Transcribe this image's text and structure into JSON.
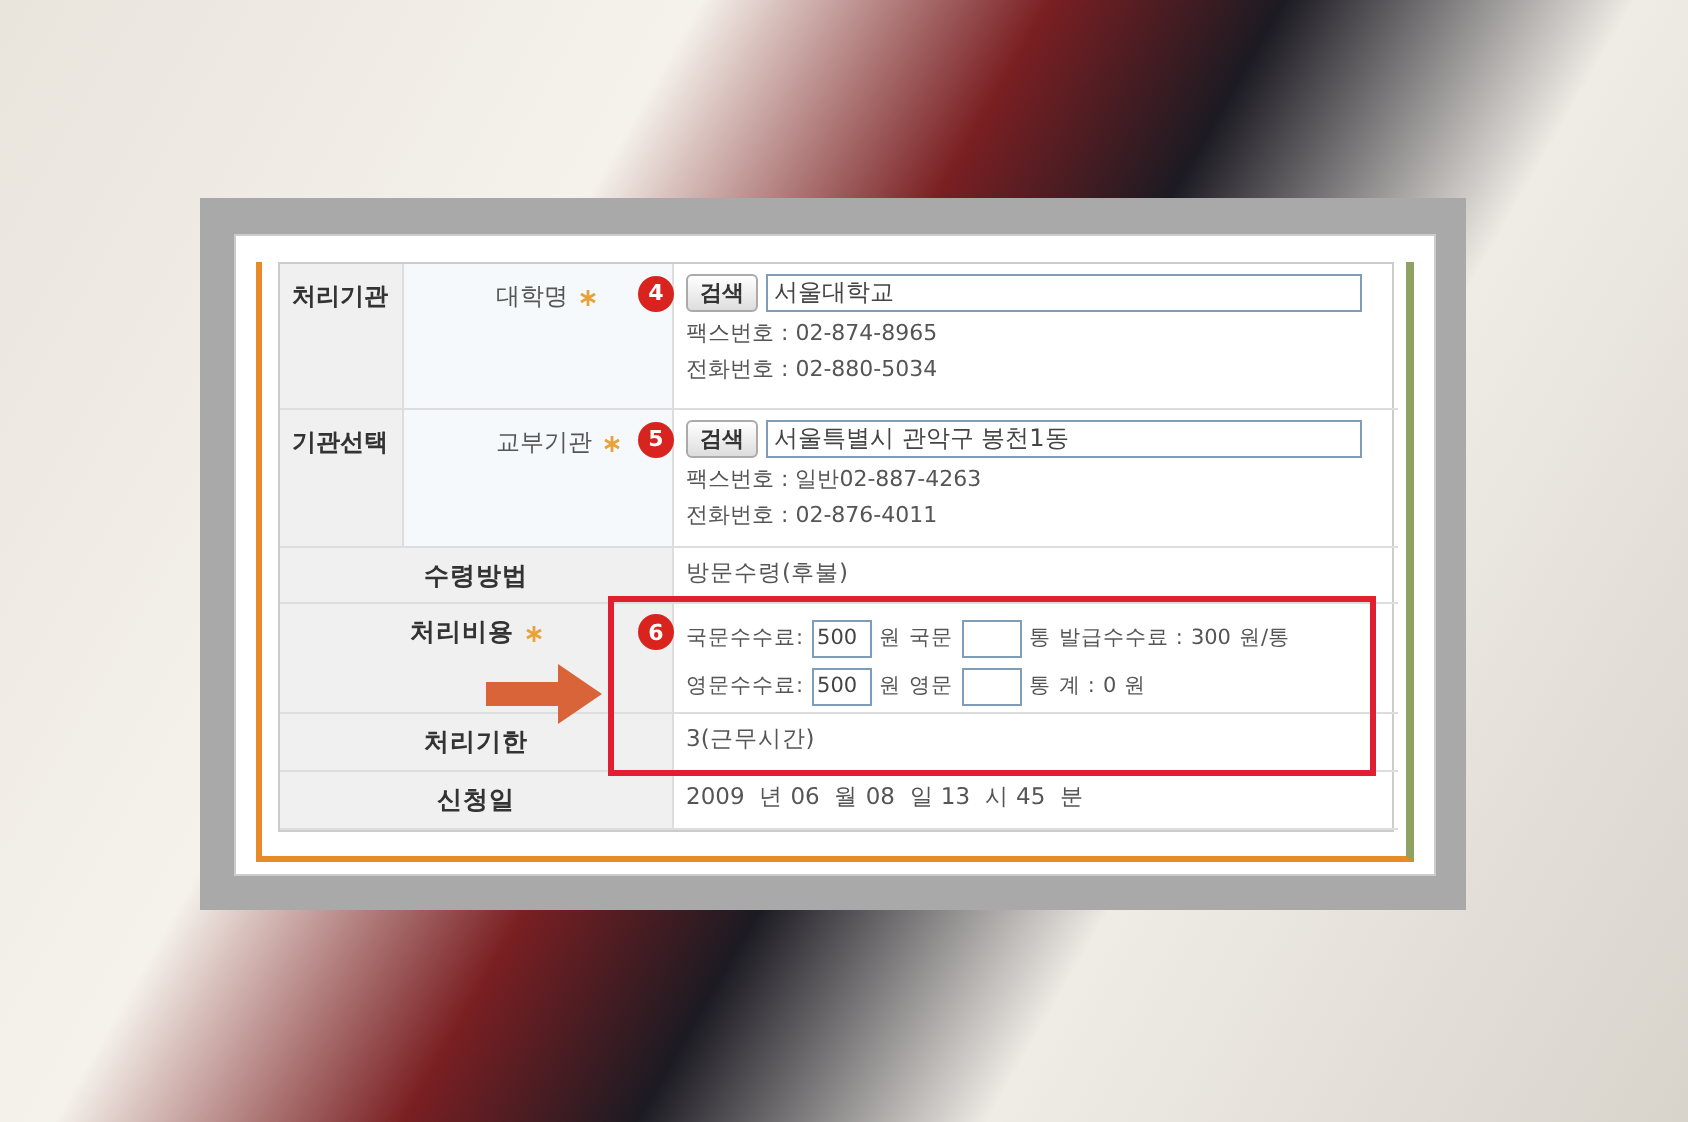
{
  "rows": [
    {
      "kind": "lookup",
      "group": "처리기관",
      "label": "대학명",
      "required": true,
      "badge": "4",
      "button": "검색",
      "value": "서울대학교",
      "details": [
        {
          "label": "팩스번호 :",
          "value": "02-874-8965"
        },
        {
          "label": "전화번호 :",
          "value": "02-880-5034"
        }
      ]
    },
    {
      "kind": "lookup",
      "group": "기관선택",
      "label": "교부기관",
      "required": true,
      "badge": "5",
      "button": "검색",
      "value": "서울특별시 관악구 봉천1동",
      "details": [
        {
          "label": "팩스번호 :",
          "value": "일반02-887-4263"
        },
        {
          "label": "전화번호 :",
          "value": "02-876-4011"
        }
      ]
    },
    {
      "kind": "text",
      "label": "수령방법",
      "required": false,
      "value": "방문수령(후불)"
    },
    {
      "kind": "fees",
      "label": "처리비용",
      "required": true,
      "badge": "6",
      "lines": [
        [
          {
            "kind": "text",
            "text": "국문수수료:"
          },
          {
            "kind": "input",
            "value": "500"
          },
          {
            "kind": "text",
            "text": "원"
          },
          {
            "kind": "text",
            "text": "국문"
          },
          {
            "kind": "input"
          },
          {
            "kind": "text",
            "text": "통"
          },
          {
            "kind": "text",
            "text": "발급수수료 :"
          },
          {
            "kind": "text",
            "text": "300"
          },
          {
            "kind": "text",
            "text": "원/통"
          }
        ],
        [
          {
            "kind": "text",
            "text": "영문수수료:"
          },
          {
            "kind": "input",
            "value": "500"
          },
          {
            "kind": "text",
            "text": "원"
          },
          {
            "kind": "text",
            "text": "영문"
          },
          {
            "kind": "input"
          },
          {
            "kind": "text",
            "text": "통"
          },
          {
            "kind": "text",
            "text": "계 :"
          },
          {
            "kind": "text",
            "text": "0"
          },
          {
            "kind": "text",
            "text": "원"
          }
        ]
      ]
    },
    {
      "kind": "text",
      "label": "처리기한",
      "required": false,
      "value": "3(근무시간)"
    },
    {
      "kind": "text",
      "label": "신청일",
      "required": false,
      "value": "2009  년 06  월 08  일 13  시 45  분"
    }
  ]
}
